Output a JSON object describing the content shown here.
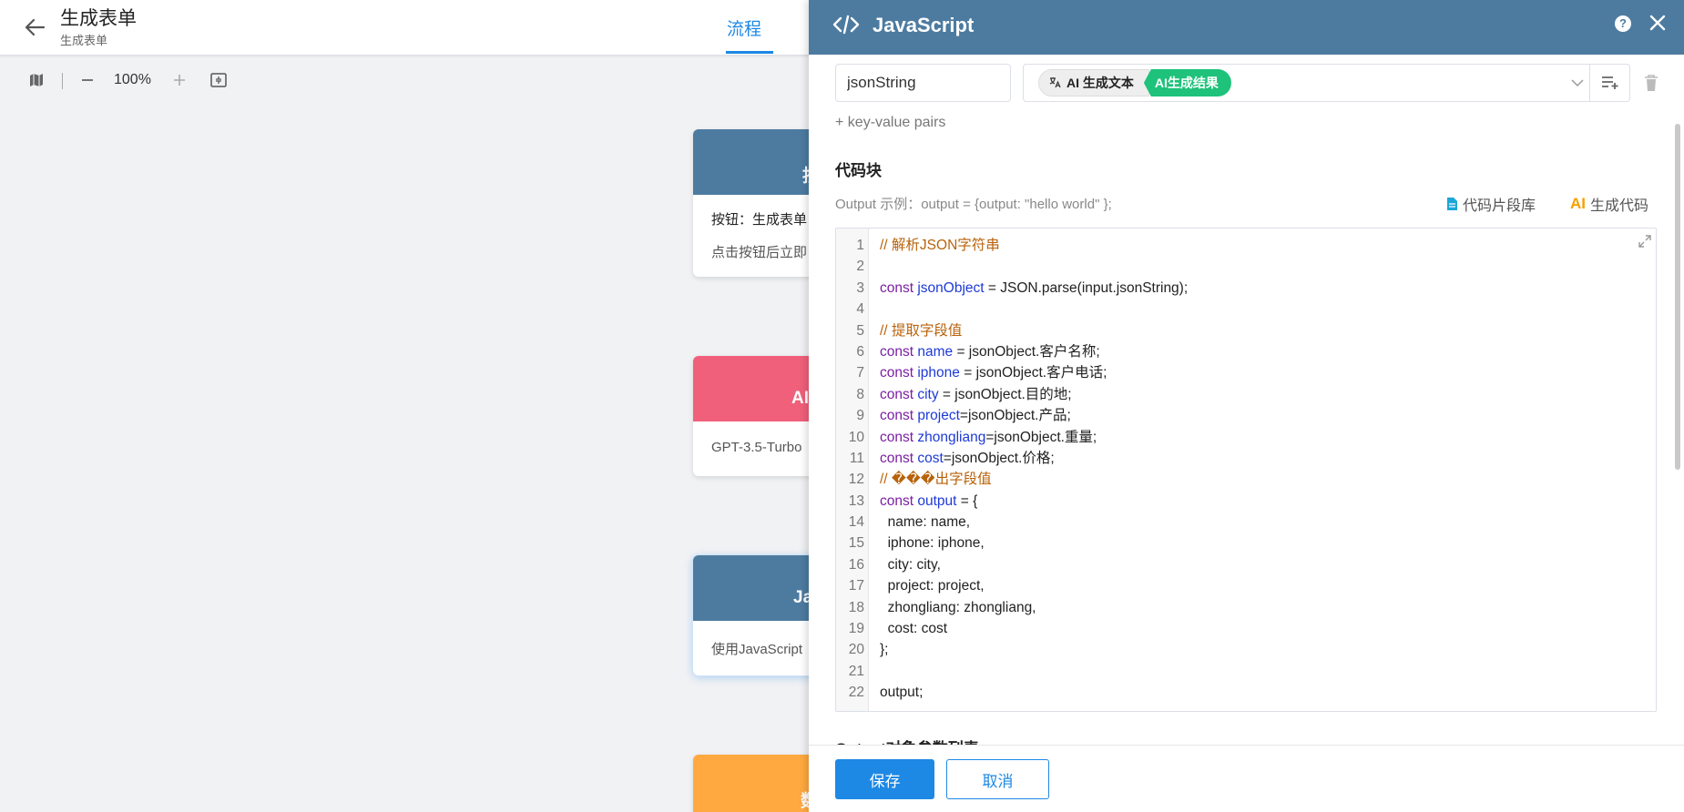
{
  "header": {
    "title": "生成表单",
    "subtitle": "生成表单",
    "tab_flow": "流程"
  },
  "toolbar": {
    "zoom": "100%",
    "zoom_out_label": "–",
    "zoom_in_label": "+"
  },
  "nodes": [
    {
      "title": "按",
      "lines": [
        "按钮：生成表单",
        "点击按钮后立即"
      ],
      "color": "#4d7ba0"
    },
    {
      "title": "AI",
      "lines": [
        "GPT-3.5-Turbo"
      ],
      "color": "#f0607a"
    },
    {
      "title": "Ja",
      "lines": [
        "使用JavaScript"
      ],
      "color": "#4d7ba0"
    },
    {
      "title": "数",
      "lines": [],
      "color": "#ffa940"
    }
  ],
  "panel": {
    "title": "JavaScript",
    "help_label": "?",
    "key_value": "jsonString",
    "tag_ai": "AI 生成文本",
    "tag_result": "AI生成结果",
    "add_kv": "+ key-value pairs",
    "section_title": "代码块",
    "output_example": "Output 示例：output = {output: \"hello world\" };",
    "snippet_library": "代码片段库",
    "gen_code_ai": "AI",
    "gen_code": "生成代码",
    "output_params": "Output对象参数列表",
    "save": "保存",
    "cancel": "取消"
  },
  "code": [
    [
      {
        "t": "// 解析JSON字符串",
        "c": "comment"
      }
    ],
    [],
    [
      {
        "t": "const ",
        "c": "kw"
      },
      {
        "t": "jsonObject",
        "c": "var"
      },
      {
        "t": " = JSON.parse(input.jsonString);",
        "c": "plain"
      }
    ],
    [],
    [
      {
        "t": "// 提取字段值",
        "c": "comment"
      }
    ],
    [
      {
        "t": "const ",
        "c": "kw"
      },
      {
        "t": "name",
        "c": "var"
      },
      {
        "t": " = jsonObject.客户名称;",
        "c": "plain"
      }
    ],
    [
      {
        "t": "const ",
        "c": "kw"
      },
      {
        "t": "iphone",
        "c": "var"
      },
      {
        "t": " = jsonObject.客户电话;",
        "c": "plain"
      }
    ],
    [
      {
        "t": "const ",
        "c": "kw"
      },
      {
        "t": "city",
        "c": "var"
      },
      {
        "t": " = jsonObject.目的地;",
        "c": "plain"
      }
    ],
    [
      {
        "t": "const ",
        "c": "kw"
      },
      {
        "t": "project",
        "c": "var"
      },
      {
        "t": "=jsonObject.产品;",
        "c": "plain"
      }
    ],
    [
      {
        "t": "const ",
        "c": "kw"
      },
      {
        "t": "zhongliang",
        "c": "var"
      },
      {
        "t": "=jsonObject.重量;",
        "c": "plain"
      }
    ],
    [
      {
        "t": "const ",
        "c": "kw"
      },
      {
        "t": "cost",
        "c": "var"
      },
      {
        "t": "=jsonObject.价格;",
        "c": "plain"
      }
    ],
    [
      {
        "t": "// ���出字段值",
        "c": "comment"
      }
    ],
    [
      {
        "t": "const ",
        "c": "kw"
      },
      {
        "t": "output",
        "c": "var"
      },
      {
        "t": " = {",
        "c": "plain"
      }
    ],
    [
      {
        "t": "  name: name,",
        "c": "plain"
      }
    ],
    [
      {
        "t": "  iphone: iphone,",
        "c": "plain"
      }
    ],
    [
      {
        "t": "  city: city,",
        "c": "plain"
      }
    ],
    [
      {
        "t": "  project: project,",
        "c": "plain"
      }
    ],
    [
      {
        "t": "  zhongliang: zhongliang,",
        "c": "plain"
      }
    ],
    [
      {
        "t": "  cost: cost",
        "c": "plain"
      }
    ],
    [
      {
        "t": "};",
        "c": "plain"
      }
    ],
    [],
    [
      {
        "t": "output;",
        "c": "plain"
      }
    ]
  ],
  "colors": {
    "accent": "#1e88e5",
    "panel_header": "#4d7ba0",
    "tag_green": "#1ec27a",
    "comment": "#b8620a",
    "keyword": "#7b1fa2",
    "variable": "#1e3ad6"
  }
}
